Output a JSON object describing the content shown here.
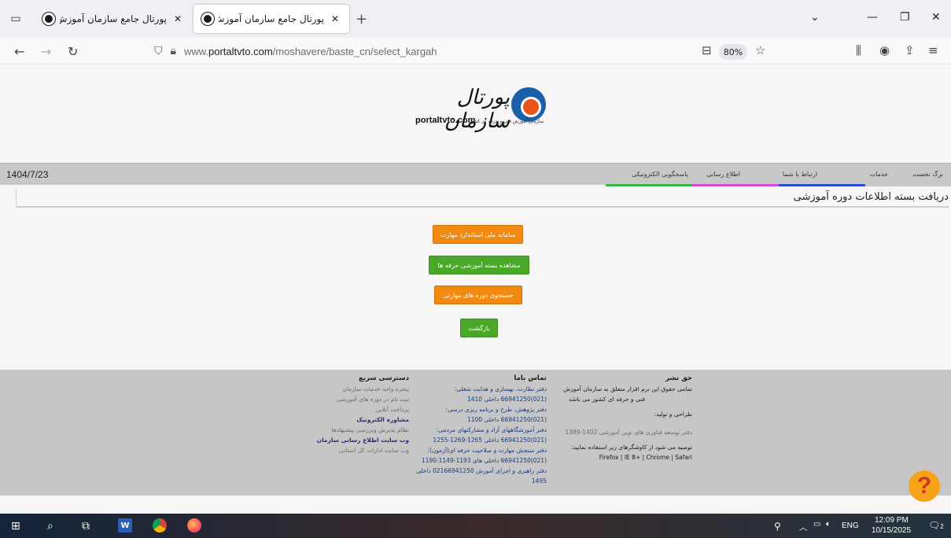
{
  "browser": {
    "tabs": [
      {
        "title": "پورتال جامع سازمان آموزش فني ..."
      },
      {
        "title": "پورتال جامع سازمان آموزش فني ..."
      }
    ],
    "url_prefix": "www.",
    "url_domain": "portaltvto.com",
    "url_path": "/moshavere/baste_cn/select_kargah",
    "zoom": "80%"
  },
  "logo": {
    "fa": "پورتال سازمان",
    "en": "portaltvto.com",
    "sub": "سازمان آموزش فنی و حرفه ای کشور"
  },
  "menu": {
    "date": "1404/7/23",
    "items": [
      "برگ نخست",
      "خدمات",
      "ارتباط با شما",
      "اطلاع رسانی",
      "پاسخگویی الکترونیکی"
    ]
  },
  "page": {
    "title": "دریافت بسته اطلاعات دوره آموزشی",
    "buttons": [
      "سامانه ملی استاندارد مهارت",
      "مشاهده بسته آموزشی حرفه ها",
      "جستجوی دوره های مهارتی",
      "بازگشت"
    ]
  },
  "footer": {
    "rights": {
      "heading": "حق نشر",
      "text1": "تمامی حقوق این نرم افزار متعلق به سازمان آموزش",
      "text2": "فنی و حرفه ای کشور می باشد",
      "producer_label": "طراحی و تولید:",
      "producer": "دفتر توسعه فناوری های نوین آموزشی 1402-1389",
      "recommend": "توصیه می شود از کاوشگرهای زیر استفاده نمایید:",
      "browsers": "Firefox | IE 8+ | Chrome | Safari"
    },
    "contact": {
      "heading": "تماس باما",
      "lines": [
        "دفتر نظارت، بهسازی و هدایت شغلی:",
        "(021)66941250 داخلی 1410",
        "دفتر پژوهش، طرح و برنامه ریزی درسی:",
        "(021)66941250 داخلی 1100",
        "دفتر آموزشگاههای آزاد و مشارکتهای مردمی:",
        "(021)66941250 داخلی 1265-1269-1255",
        "دفتر سنجش مهارت و صلاحیت حرفه ای(آزمون):",
        "(021)66941250 داخلی های 1193-1149-1190",
        "دفتر راهبری و اجرای آموزش 02166941250 داخلی",
        "1495"
      ]
    },
    "quick": {
      "heading": "دسترسی سریع",
      "links": [
        "پنجره واحد خدمات سازمان",
        "ثبت نام در دوره های آموزشی",
        "پرداخت آنلاین",
        "مشاوره الکترونیک",
        "نظام پذیرش وبررسی پیشنهادها",
        "وب سایت اطلاع رسانی سازمان",
        "وب سایت ادارات کل استانی"
      ]
    }
  },
  "taskbar": {
    "lang": "ENG",
    "time": "12:09 PM",
    "date": "10/15/2025",
    "notif": "2"
  }
}
